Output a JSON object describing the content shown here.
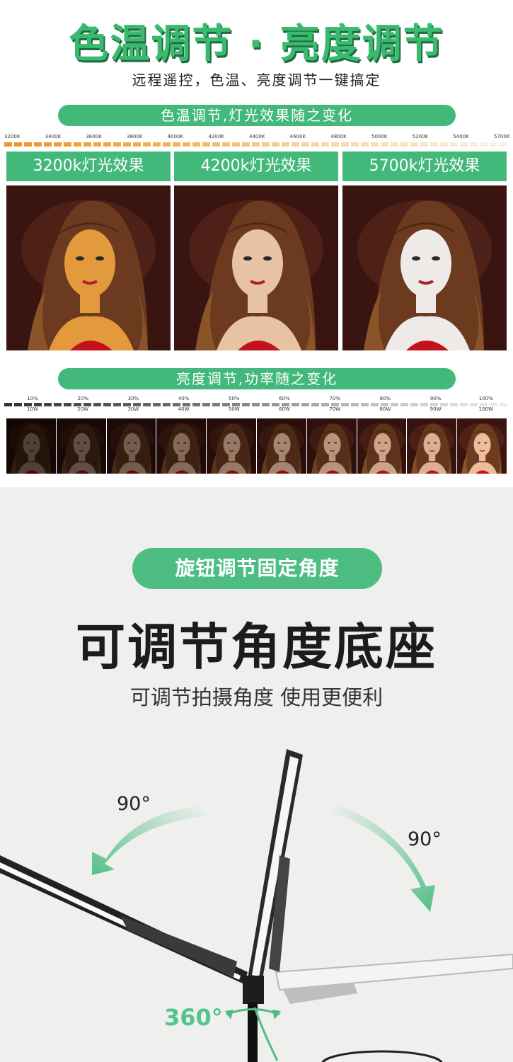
{
  "header": {
    "title": "色温调节 · 亮度调节",
    "subtitle": "远程遥控，色温、亮度调节一键搞定"
  },
  "color_temp": {
    "bar_label": "色温调节,灯光效果随之变化",
    "scale": [
      "3200K",
      "3400K",
      "3600K",
      "3800K",
      "4000K",
      "4200K",
      "4400K",
      "4600K",
      "4800K",
      "5000K",
      "5200K",
      "5400K",
      "5700K"
    ],
    "panels": [
      {
        "label": "3200k灯光效果",
        "tint": "#e39a3c"
      },
      {
        "label": "4200k灯光效果",
        "tint": "#e8c3a3"
      },
      {
        "label": "5700k灯光效果",
        "tint": "#eeeae8"
      }
    ]
  },
  "brightness": {
    "bar_label": "亮度调节,功率随之变化",
    "levels": [
      {
        "pct": "10%",
        "watt": "10W"
      },
      {
        "pct": "20%",
        "watt": "20W"
      },
      {
        "pct": "30%",
        "watt": "30W"
      },
      {
        "pct": "40%",
        "watt": "40W"
      },
      {
        "pct": "50%",
        "watt": "50W"
      },
      {
        "pct": "60%",
        "watt": "60W"
      },
      {
        "pct": "70%",
        "watt": "70W"
      },
      {
        "pct": "80%",
        "watt": "80W"
      },
      {
        "pct": "90%",
        "watt": "90W"
      },
      {
        "pct": "100%",
        "watt": "100W"
      }
    ]
  },
  "angle": {
    "pill": "旋钮调节固定角度",
    "headline": "可调节角度底座",
    "tagline": "可调节拍摄角度 使用更便利",
    "left_deg": "90°",
    "right_deg": "90°",
    "rotate_deg": "360°",
    "accent": "#4dbd82"
  }
}
